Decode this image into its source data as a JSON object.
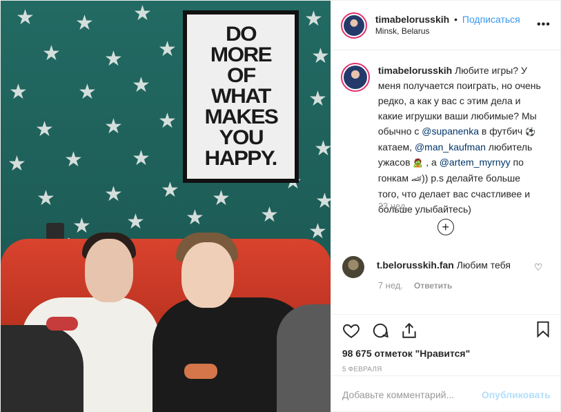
{
  "photo": {
    "poster_lines": [
      "DO",
      "MORE",
      "OF",
      "WHAT",
      "MAKES",
      "YOU",
      "HAPPY."
    ]
  },
  "header": {
    "username": "timabelorusskih",
    "separator": "•",
    "follow_label": "Подписаться",
    "location": "Minsk, Belarus",
    "more_icon": "•••"
  },
  "caption": {
    "username": "timabelorusskih",
    "p1": " Любите игры? У меня получается поиграть, но очень редко, а как у вас с этим дела и какие игрушки ваши любимые? Мы обычно с ",
    "mention1": "@supanenka",
    "p2": " в футбич ",
    "emoji1": "⚽",
    "p3": " катаем, ",
    "mention2": "@man_kaufman",
    "p4": " любитель ужасов ",
    "emoji2": "🧟",
    "p5": " , а ",
    "mention3": "@artem_myrnyy",
    "p6": " по гонкам ",
    "emoji3": "🏎",
    "p7": ")) p.s делайте больше того, что делает вас счастливее и больше улыбайтесь)",
    "time": "23 нед."
  },
  "load_more_icon": "+",
  "comment": {
    "username": "t.belorusskih.fan",
    "text": " Любим тебя",
    "time": "7 нед.",
    "reply": "Ответить",
    "heart": "♡"
  },
  "stats": {
    "likes": "98 675 отметок \"Нравится\"",
    "date": "5 ФЕВРАЛЯ"
  },
  "add_comment": {
    "placeholder": "Добавьте комментарий...",
    "publish": "Опубликовать"
  },
  "colors": {
    "link": "#3897f0",
    "mention": "#003569",
    "muted": "#999999",
    "publish_disabled": "#b2dffc"
  }
}
